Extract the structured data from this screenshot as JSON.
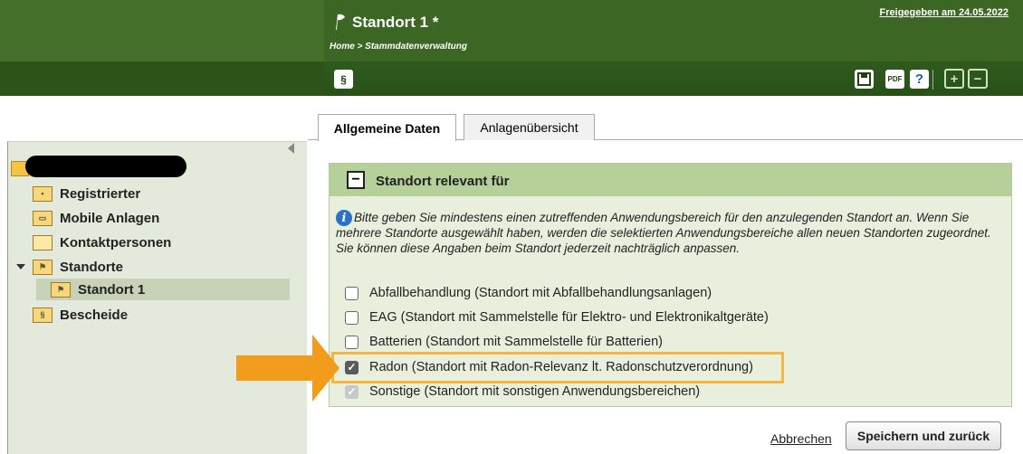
{
  "header": {
    "title": "Standort 1 *",
    "breadcrumb": "Home > Stammdatenverwaltung",
    "released": "Freigegeben am 24.05.2022"
  },
  "toolbar": {
    "law_icon": "§",
    "save_icon": "save-icon",
    "pdf_icon": "pdf-icon",
    "help_icon": "?",
    "expand_icon": "+",
    "collapse_icon": "−"
  },
  "tree": {
    "root_label_redacted": true,
    "items": [
      {
        "label": "Registrierter",
        "icon": "registered-icon"
      },
      {
        "label": "Mobile Anlagen",
        "icon": "mobile-plant-icon"
      },
      {
        "label": "Kontaktpersonen",
        "icon": "folder-icon"
      },
      {
        "label": "Standorte",
        "icon": "location-folder-icon",
        "expanded": true
      },
      {
        "label": "Standort 1",
        "icon": "location-icon",
        "selected": true
      },
      {
        "label": "Bescheide",
        "icon": "decision-icon"
      }
    ]
  },
  "tabs": [
    {
      "label": "Allgemeine Daten",
      "active": true
    },
    {
      "label": "Anlagenübersicht",
      "active": false
    }
  ],
  "section": {
    "title": "Standort relevant für",
    "info": "Bitte geben Sie mindestens einen zutreffenden Anwendungsbereich für den anzulegenden Standort an. Wenn Sie mehrere Standorte ausgewählt haben, werden die selektierten Anwendungsbereiche allen neuen Standorten zugeordnet. Sie können diese Angaben beim Standort jederzeit nachträglich anpassen.",
    "options": [
      {
        "label": "Abfallbehandlung (Standort mit Abfallbehandlungsanlagen)",
        "checked": false,
        "disabled": false
      },
      {
        "label": "EAG (Standort mit Sammelstelle für Elektro- und Elektronikaltgeräte)",
        "checked": false,
        "disabled": false
      },
      {
        "label": "Batterien (Standort mit Sammelstelle für Batterien)",
        "checked": false,
        "disabled": false
      },
      {
        "label": "Radon (Standort mit Radon-Relevanz lt. Radonschutzverordnung)",
        "checked": true,
        "disabled": false
      },
      {
        "label": "Sonstige (Standort mit sonstigen Anwendungsbereichen)",
        "checked": true,
        "disabled": true
      }
    ]
  },
  "actions": {
    "cancel": "Abbrechen",
    "save": "Speichern und zurück"
  },
  "colors": {
    "header": "#3b6624",
    "toolbar": "#2d5319",
    "section_head": "#b6d09a",
    "highlight": "#f5b63b",
    "arrow": "#f29c1c"
  }
}
